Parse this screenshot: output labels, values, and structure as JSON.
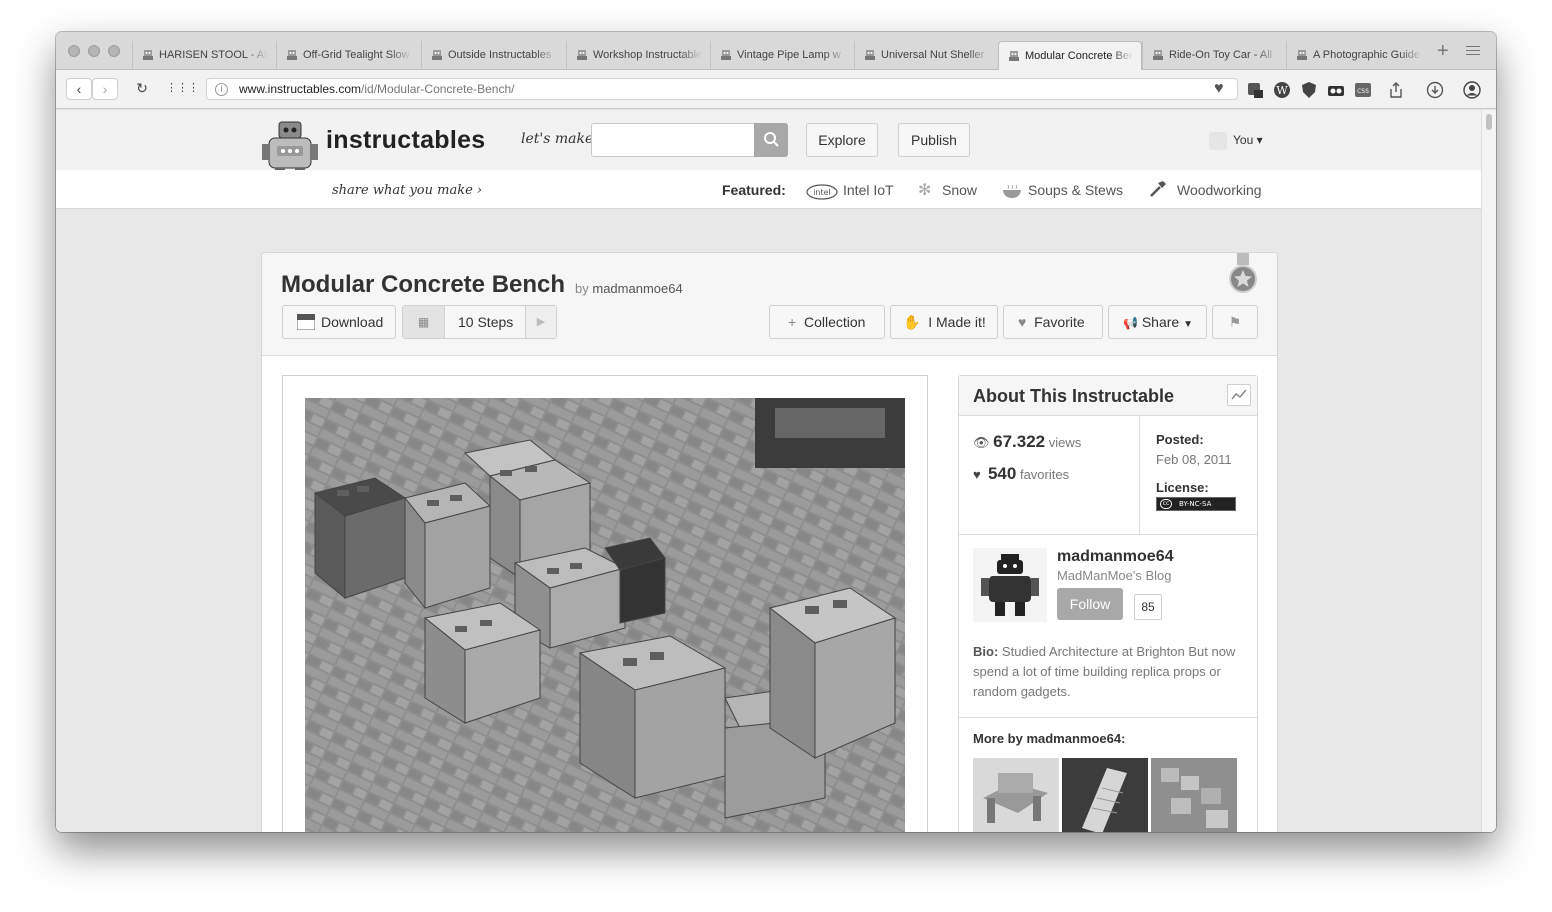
{
  "browser": {
    "tabs": [
      {
        "label": "HARISEN STOOL - All",
        "active": false
      },
      {
        "label": "Off-Grid Tealight Slow",
        "active": false
      },
      {
        "label": "Outside Instructables",
        "active": false
      },
      {
        "label": "Workshop Instructables",
        "active": false
      },
      {
        "label": "Vintage Pipe Lamp w",
        "active": false
      },
      {
        "label": "Universal Nut Sheller",
        "active": false
      },
      {
        "label": "Modular Concrete Bench",
        "active": true
      },
      {
        "label": "Ride-On Toy Car - All",
        "active": false
      },
      {
        "label": "A Photographic Guide",
        "active": false
      }
    ],
    "url_host": "www.instructables.com",
    "url_path": "/id/Modular-Concrete-Bench/"
  },
  "site": {
    "logo": "instructables",
    "tagline": "share what you make",
    "lets_make": "let's make",
    "explore": "Explore",
    "publish": "Publish",
    "you": "You",
    "featured_label": "Featured:",
    "featured": [
      "Intel IoT",
      "Snow",
      "Soups & Stews",
      "Woodworking"
    ]
  },
  "project": {
    "title": "Modular Concrete Bench",
    "by": "by",
    "author": "madmanmoe64",
    "download": "Download",
    "steps": "10 Steps",
    "collection": "Collection",
    "made_it": "I Made it!",
    "favorite": "Favorite",
    "share": "Share"
  },
  "about": {
    "title": "About This Instructable",
    "views": "67.322",
    "views_label": "views",
    "favorites": "540",
    "favorites_label": "favorites",
    "posted_label": "Posted:",
    "posted": "Feb 08, 2011",
    "license_label": "License:",
    "license_badge": "BY-NC-SA",
    "author": "madmanmoe64",
    "blog": "MadManMoe's Blog",
    "follow": "Follow",
    "followers": "85",
    "bio_label": "Bio:",
    "bio": "Studied Architecture at Brighton But now spend a lot of time building replica props or random gadgets.",
    "more_by": "More by madmanmoe64:"
  },
  "colors": {
    "header_bg": "#f2f2f2",
    "follow_bg": "#a8a8a8",
    "page_bg": "#e8e8e8"
  }
}
